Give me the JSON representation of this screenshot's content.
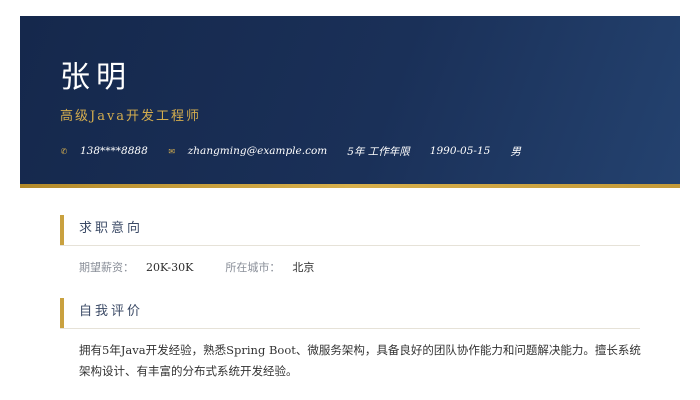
{
  "header": {
    "name": "张明",
    "title": "高级Java开发工程师",
    "contacts": {
      "phone": {
        "icon": "phone-icon",
        "glyph": "✆",
        "value": "138****8888"
      },
      "email": {
        "icon": "mail-icon",
        "glyph": "✉",
        "value": "zhangming@example.com"
      },
      "experience": "5年 工作年限",
      "birthday": "1990-05-15",
      "gender": "男"
    }
  },
  "sections": {
    "intent": {
      "title": "求职意向",
      "salary_key": "期望薪资：",
      "salary_value": "20K-30K",
      "city_key": "所在城市：",
      "city_value": "北京"
    },
    "summary": {
      "title": "自我评价",
      "text": "拥有5年Java开发经验，熟悉Spring Boot、微服务架构，具备良好的团队协作能力和问题解决能力。擅长系统架构设计、有丰富的分布式系统开发经验。"
    }
  },
  "colors": {
    "header_bg": "#1a3058",
    "accent_gold": "#c9a13f",
    "section_title": "#3b4a66"
  }
}
